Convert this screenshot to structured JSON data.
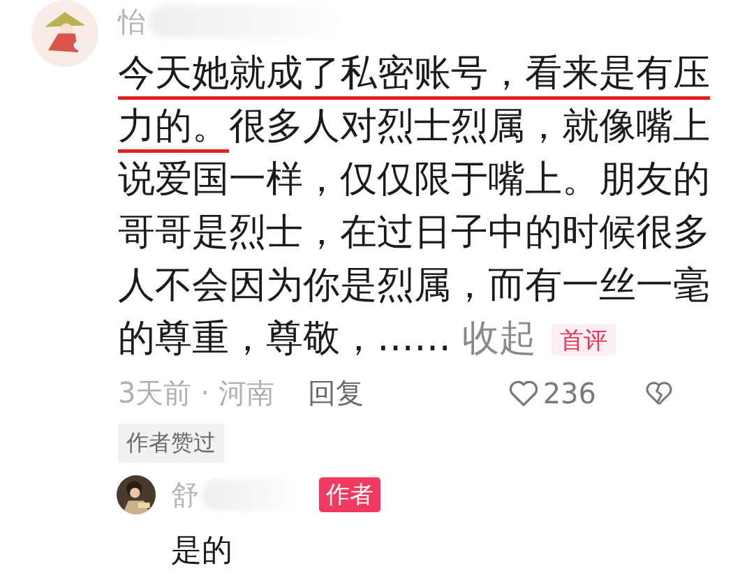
{
  "comment": {
    "username": "怡",
    "text_highlighted": "今天她就成了私密账号，看来是有压力的。",
    "text_rest": "很多人对烈士烈属，就像嘴上说爱国一样，仅仅限于嘴上。朋友的哥哥是烈士，在过日子中的时候很多人不会因为你是烈属，而有一丝一毫的尊重，尊敬，……",
    "collapse_link": "收起",
    "badge": "首评",
    "time": "3天前",
    "separator": "·",
    "location": "河南",
    "reply_button": "回复",
    "likes": "236",
    "liked_by_author": "作者赞过"
  },
  "reply": {
    "username": "舒",
    "author_badge": "作者",
    "text": "是的"
  }
}
